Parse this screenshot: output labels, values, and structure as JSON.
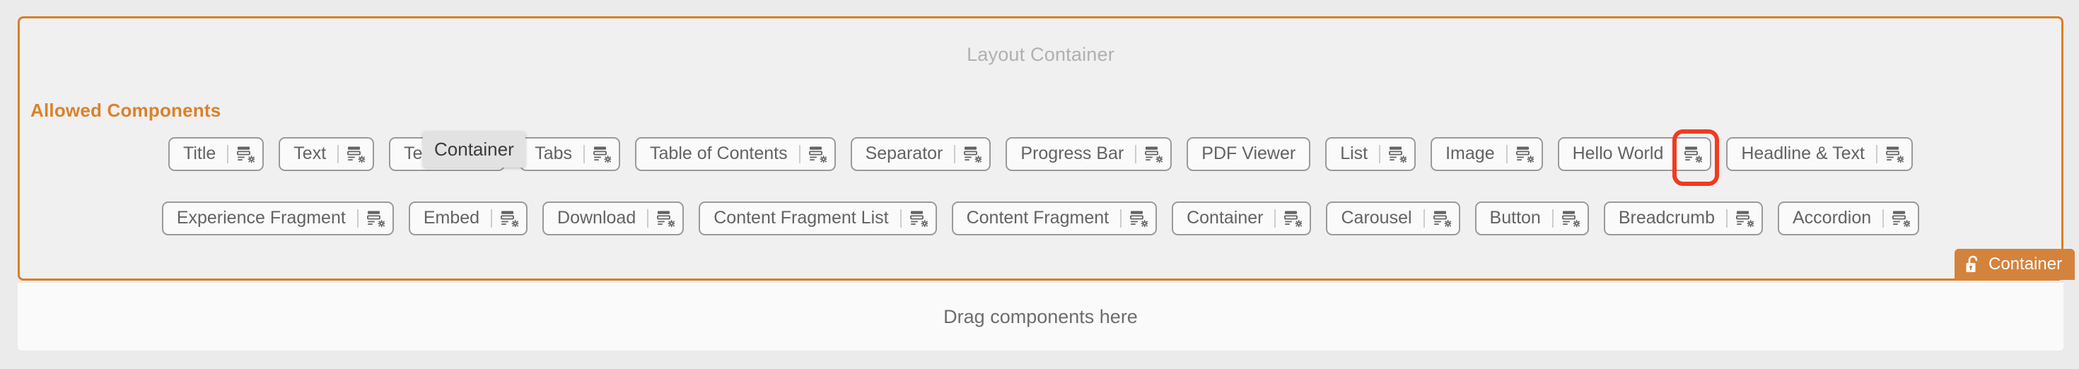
{
  "layout": {
    "title": "Layout Container",
    "allowed_heading": "Allowed Components",
    "border_color": "#d98026",
    "accent_color": "#d9822b"
  },
  "tooltip": {
    "text": "Container"
  },
  "badge": {
    "label": "Container",
    "icon": "unlock-icon",
    "background_color": "#d4833c",
    "text_color": "#ffffff"
  },
  "dropzone": {
    "text": "Drag components here"
  },
  "annotation": {
    "highlight_color": "#ef3b22",
    "target": "hello-world-policy-icon"
  },
  "component_rows": [
    {
      "row_index": 0,
      "chips": [
        {
          "label": "Title",
          "icon": "policy-gear-icon",
          "has_icon": true,
          "highlighted": false
        },
        {
          "label": "Text",
          "icon": "policy-gear-icon",
          "has_icon": true,
          "highlighted": false
        },
        {
          "label": "Teaser",
          "icon": "policy-gear-icon",
          "has_icon": true,
          "highlighted": false
        },
        {
          "label": "Tabs",
          "icon": "policy-gear-icon",
          "has_icon": true,
          "highlighted": false
        },
        {
          "label": "Table of Contents",
          "icon": "policy-gear-icon",
          "has_icon": true,
          "highlighted": false
        },
        {
          "label": "Separator",
          "icon": "policy-gear-icon",
          "has_icon": true,
          "highlighted": false
        },
        {
          "label": "Progress Bar",
          "icon": "policy-gear-icon",
          "has_icon": true,
          "highlighted": false
        },
        {
          "label": "PDF Viewer",
          "icon": "",
          "has_icon": false,
          "highlighted": false
        },
        {
          "label": "List",
          "icon": "policy-gear-icon",
          "has_icon": true,
          "highlighted": false
        },
        {
          "label": "Image",
          "icon": "policy-gear-icon",
          "has_icon": true,
          "highlighted": false
        },
        {
          "label": "Hello World",
          "icon": "policy-gear-icon",
          "has_icon": true,
          "highlighted": true
        },
        {
          "label": "Headline & Text",
          "icon": "policy-gear-icon",
          "has_icon": true,
          "highlighted": false
        }
      ]
    },
    {
      "row_index": 1,
      "chips": [
        {
          "label": "Experience Fragment",
          "icon": "policy-gear-icon",
          "has_icon": true,
          "highlighted": false
        },
        {
          "label": "Embed",
          "icon": "policy-gear-icon",
          "has_icon": true,
          "highlighted": false
        },
        {
          "label": "Download",
          "icon": "policy-gear-icon",
          "has_icon": true,
          "highlighted": false
        },
        {
          "label": "Content Fragment List",
          "icon": "policy-gear-icon",
          "has_icon": true,
          "highlighted": false
        },
        {
          "label": "Content Fragment",
          "icon": "policy-gear-icon",
          "has_icon": true,
          "highlighted": false
        },
        {
          "label": "Container",
          "icon": "policy-gear-icon",
          "has_icon": true,
          "highlighted": false
        },
        {
          "label": "Carousel",
          "icon": "policy-gear-icon",
          "has_icon": true,
          "highlighted": false
        },
        {
          "label": "Button",
          "icon": "policy-gear-icon",
          "has_icon": true,
          "highlighted": false
        },
        {
          "label": "Breadcrumb",
          "icon": "policy-gear-icon",
          "has_icon": true,
          "highlighted": false
        },
        {
          "label": "Accordion",
          "icon": "policy-gear-icon",
          "has_icon": true,
          "highlighted": false
        }
      ]
    }
  ]
}
